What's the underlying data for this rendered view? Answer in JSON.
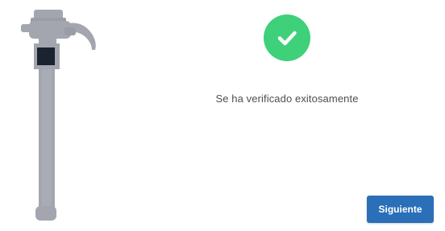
{
  "illustration": {
    "icon": "hydrant-valve-icon",
    "body_color": "#a3a6ae",
    "marker_color": "#1b2230"
  },
  "status": {
    "icon": "checkmark-icon",
    "badge_color": "#3fd07a",
    "message": "Se ha verificado exitosamente"
  },
  "actions": {
    "next_label": "Siguiente",
    "button_color": "#2a6fb8"
  }
}
